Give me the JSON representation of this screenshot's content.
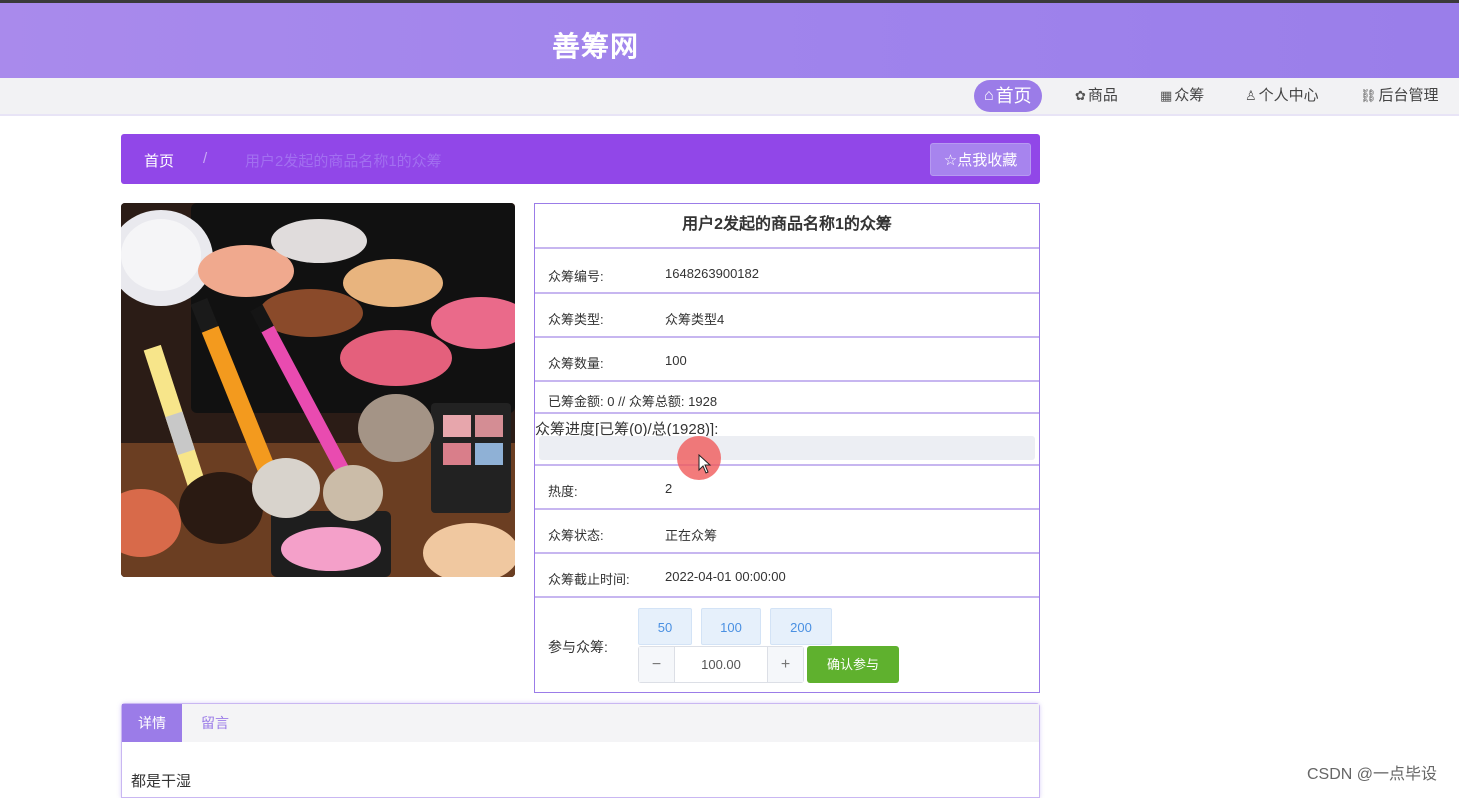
{
  "header": {
    "title": "善筹网"
  },
  "nav": {
    "home": "首页",
    "goods": "商品",
    "crowdfunding": "众筹",
    "user_center": "个人中心",
    "admin": "后台管理"
  },
  "breadcrumb": {
    "home": "首页",
    "separator": "/",
    "current": "用户2发起的商品名称1的众筹",
    "favorite_button": "☆点我收藏"
  },
  "product": {
    "title": "用户2发起的商品名称1的众筹",
    "image_alt": "化妆品",
    "fields": {
      "number_label": "众筹编号:",
      "number_value": "1648263900182",
      "type_label": "众筹类型:",
      "type_value": "众筹类型4",
      "quantity_label": "众筹数量:",
      "quantity_value": "100",
      "amount_text": "已筹金额: 0 // 众筹总额: 1928",
      "progress_label": "众筹进度[已筹(0)/总(1928)]:",
      "progress_fraction": 0,
      "heat_label": "热度:",
      "heat_value": "2",
      "status_label": "众筹状态:",
      "status_value": "正在众筹",
      "deadline_label": "众筹截止时间:",
      "deadline_value": "2022-04-01 00:00:00"
    },
    "participate": {
      "label": "参与众筹:",
      "amounts": [
        "50",
        "100",
        "200"
      ],
      "stepper_minus": "−",
      "stepper_plus": "+",
      "stepper_value": "100.00",
      "confirm": "确认参与"
    }
  },
  "tabs": {
    "detail": "详情",
    "messages": "留言",
    "detail_text": "都是干湿"
  },
  "watermark": "CSDN @一点毕设",
  "colors": {
    "header": "#a084ec",
    "accent": "#9b7ce8",
    "breadcrumb_bar": "#9147e8",
    "confirm": "#5fb12e"
  }
}
